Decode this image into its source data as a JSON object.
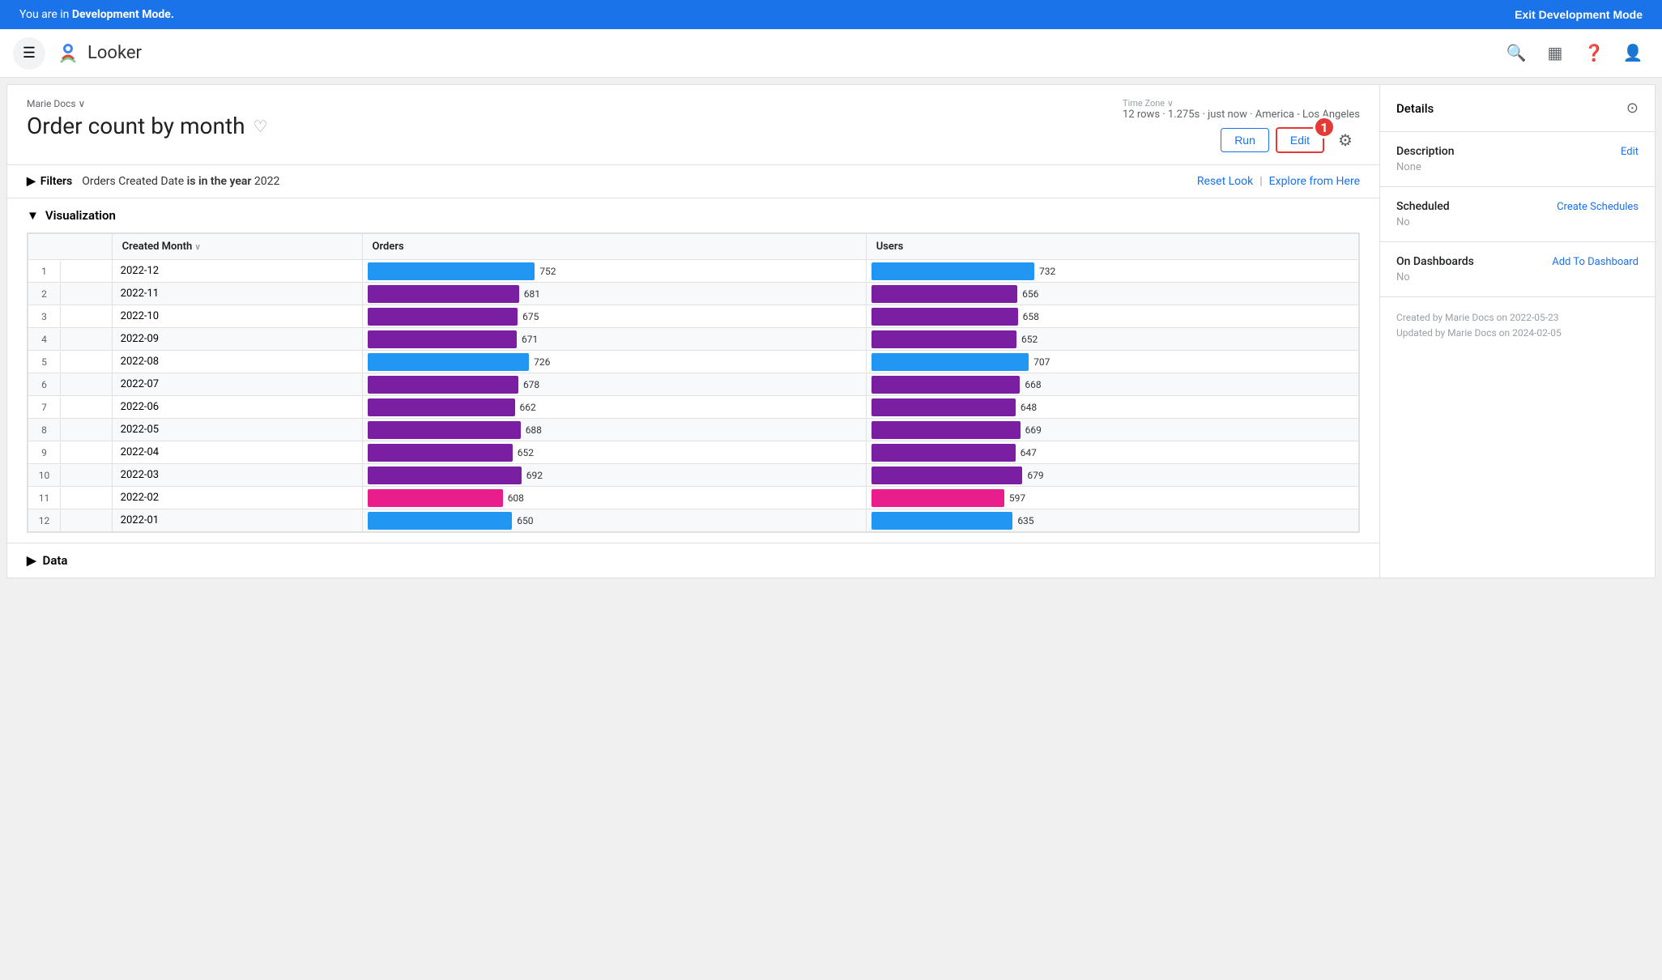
{
  "devBanner": {
    "text": "You are in ",
    "boldText": "Development Mode.",
    "exitLabel": "Exit Development Mode"
  },
  "topNav": {
    "appName": "Looker",
    "icons": [
      "search",
      "grid",
      "help",
      "user"
    ]
  },
  "pageHeader": {
    "breadcrumb": "Marie Docs ∨",
    "title": "Order count by month",
    "metaLine": "12 rows · 1.275s · just now · America - Los Angeles",
    "timeZoneLabel": "Time Zone ∨",
    "runLabel": "Run",
    "editLabel": "Edit",
    "badgeNumber": "1"
  },
  "filters": {
    "label": "Filters",
    "filterText": "Orders Created Date",
    "filterOperator": "is in the year",
    "filterValue": "2022",
    "resetLabel": "Reset Look",
    "exploreLabel": "Explore from Here"
  },
  "visualization": {
    "sectionLabel": "Visualization",
    "columns": [
      {
        "key": "row",
        "label": ""
      },
      {
        "key": "month",
        "label": "Created Month",
        "sortable": true
      },
      {
        "key": "orders",
        "label": "Orders"
      },
      {
        "key": "users",
        "label": "Users"
      }
    ],
    "rows": [
      {
        "num": 1,
        "month": "2022-12",
        "orders": 752,
        "users": 732,
        "ordersColor": "#2196F3",
        "usersColor": "#2196F3"
      },
      {
        "num": 2,
        "month": "2022-11",
        "orders": 681,
        "users": 656,
        "ordersColor": "#7B1FA2",
        "usersColor": "#7B1FA2"
      },
      {
        "num": 3,
        "month": "2022-10",
        "orders": 675,
        "users": 658,
        "ordersColor": "#7B1FA2",
        "usersColor": "#7B1FA2"
      },
      {
        "num": 4,
        "month": "2022-09",
        "orders": 671,
        "users": 652,
        "ordersColor": "#7B1FA2",
        "usersColor": "#7B1FA2"
      },
      {
        "num": 5,
        "month": "2022-08",
        "orders": 726,
        "users": 707,
        "ordersColor": "#2196F3",
        "usersColor": "#2196F3"
      },
      {
        "num": 6,
        "month": "2022-07",
        "orders": 678,
        "users": 668,
        "ordersColor": "#7B1FA2",
        "usersColor": "#7B1FA2"
      },
      {
        "num": 7,
        "month": "2022-06",
        "orders": 662,
        "users": 648,
        "ordersColor": "#7B1FA2",
        "usersColor": "#7B1FA2"
      },
      {
        "num": 8,
        "month": "2022-05",
        "orders": 688,
        "users": 669,
        "ordersColor": "#7B1FA2",
        "usersColor": "#7B1FA2"
      },
      {
        "num": 9,
        "month": "2022-04",
        "orders": 652,
        "users": 647,
        "ordersColor": "#7B1FA2",
        "usersColor": "#7B1FA2"
      },
      {
        "num": 10,
        "month": "2022-03",
        "orders": 692,
        "users": 679,
        "ordersColor": "#7B1FA2",
        "usersColor": "#7B1FA2"
      },
      {
        "num": 11,
        "month": "2022-02",
        "orders": 608,
        "users": 597,
        "ordersColor": "#E91E8C",
        "usersColor": "#E91E8C"
      },
      {
        "num": 12,
        "month": "2022-01",
        "orders": 650,
        "users": 635,
        "ordersColor": "#2196F3",
        "usersColor": "#2196F3"
      }
    ],
    "maxValue": 800
  },
  "dataSectionLabel": "Data",
  "rightPanel": {
    "detailsLabel": "Details",
    "description": {
      "label": "Description",
      "editLabel": "Edit",
      "value": "None"
    },
    "scheduled": {
      "label": "Scheduled",
      "actionLabel": "Create Schedules",
      "value": "No"
    },
    "onDashboards": {
      "label": "On Dashboards",
      "actionLabel": "Add To Dashboard",
      "value": "No"
    },
    "createdInfo": "Created by Marie Docs on 2022-05-23",
    "updatedInfo": "Updated by Marie Docs on 2024-02-05"
  }
}
